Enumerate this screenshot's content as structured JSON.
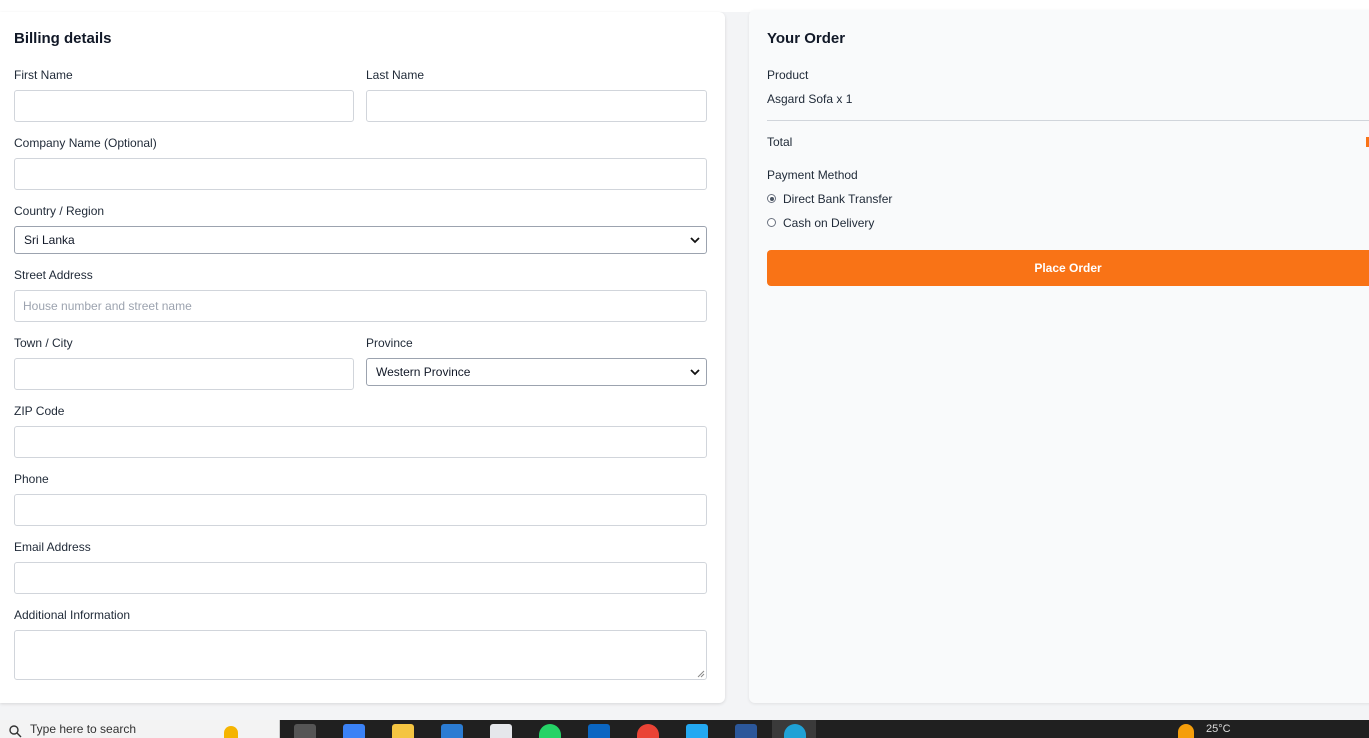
{
  "billing": {
    "title": "Billing details",
    "first_name_label": "First Name",
    "first_name_value": "",
    "last_name_label": "Last Name",
    "last_name_value": "",
    "company_label": "Company Name (Optional)",
    "company_value": "",
    "country_label": "Country / Region",
    "country_value": "Sri Lanka",
    "street_label": "Street Address",
    "street_placeholder": "House number and street name",
    "town_label": "Town / City",
    "town_value": "",
    "province_label": "Province",
    "province_value": "Western Province",
    "zip_label": "ZIP Code",
    "zip_value": "",
    "phone_label": "Phone",
    "phone_value": "",
    "email_label": "Email Address",
    "email_value": "",
    "additional_label": "Additional Information",
    "additional_value": ""
  },
  "order": {
    "title": "Your Order",
    "product_header": "Product",
    "product_line": "Asgard Sofa x 1",
    "total_label": "Total",
    "payment_label": "Payment Method",
    "payment_options": [
      {
        "label": "Direct Bank Transfer",
        "selected": true
      },
      {
        "label": "Cash on Delivery",
        "selected": false
      }
    ],
    "place_order_label": "Place Order"
  },
  "taskbar": {
    "search_text": "Type here to search",
    "weather_text": "25°C",
    "icons": [
      "task-view-icon",
      "copilot-icon",
      "file-explorer-icon",
      "mail-icon",
      "store-icon",
      "whatsapp-icon",
      "linkedin-icon",
      "chrome-icon",
      "vscode-icon",
      "word-icon",
      "edge-icon"
    ]
  },
  "colors": {
    "accent": "#f97316",
    "page_bg": "#f3f4f6",
    "order_bg": "#f9fafb",
    "border": "#d1d5db"
  }
}
